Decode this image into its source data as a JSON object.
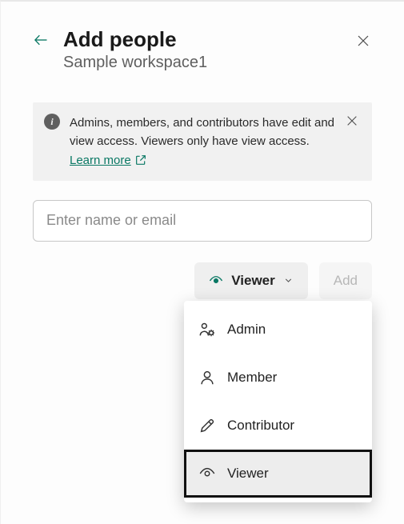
{
  "header": {
    "title": "Add people",
    "subtitle": "Sample workspace1"
  },
  "banner": {
    "text": "Admins, members, and contributors have edit and view access. Viewers only have view access. ",
    "learn_more": "Learn more "
  },
  "input": {
    "placeholder": "Enter name or email"
  },
  "roleSelector": {
    "current": "Viewer"
  },
  "addButton": {
    "label": "Add"
  },
  "roles": {
    "admin": "Admin",
    "member": "Member",
    "contributor": "Contributor",
    "viewer": "Viewer"
  }
}
